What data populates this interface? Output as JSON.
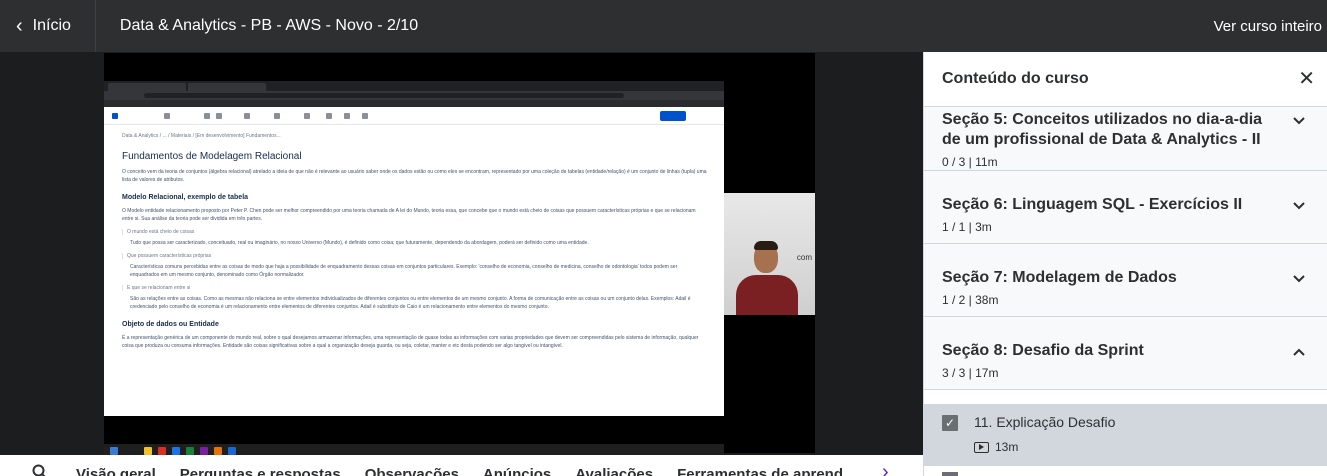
{
  "header": {
    "back_label": "Início",
    "course_title": "Data & Analytics - PB - AWS - Novo - 2/10",
    "view_course": "Ver curso inteiro"
  },
  "video": {
    "doc_crumbs": "Data & Analytics  /  ...  /  Materiais  /  [Em desenvolvimento] Fundamentos...",
    "doc_title": "Fundamentos de Modelagem Relacional",
    "doc_intro": "O conceito vem da teoria de conjuntos (álgebra relacional) atrelado a ideia de que não é relevante ao usuário saber onde os dados estão ou como eles se encontram, representado por uma coleção de tabelas (entidade/relação) é um conjunto de linhas (tupla) uma lista de valores de atributos.",
    "doc_h2a": "Modelo Relacional, exemplo de tabela",
    "doc_p2": "O Modelo entidade relacionamento proposto por Peter P. Chen pode ser melhor compreendido por uma teoria chamada de A lei do Mundo, teoria essa, que concebe que o mundo está cheio de coisas que possuem características próprias e que se relacionam entre si. Sua análise da teoria pode ser dividida em três partes.",
    "doc_q1": "O mundo está cheio de coisas",
    "doc_i1": "Tudo que possa ser caracterizado, conceituado, real ou imaginário, no nosso Universo (Mundo), é definido como coisa; que futuramente, dependendo da abordagem, poderá ser definido como uma entidade.",
    "doc_q2": "Que possuem características próprias",
    "doc_i2": "Características comuns percebidas entre as coisas de modo que haja a possibilidade de enquadramento dessas coisas em conjuntos particulares. Exemplo: 'conselho de economia, conselho de medicina, conselho de odontologia' todos podem ser enquadrados em um mesmo conjunto, denominado como Órgão normalizador.",
    "doc_q3": "E que se relacionam entre si",
    "doc_i3": "São as relações entre as coisas. Como as mesmas não relaciona se entre elementos individualizados de diferentes conjuntos ou entre elementos de um mesmo conjunto. A forma de comunicação entre as coisas ou um conjunto delas. Exemplos: Adail é credenciado pelo conselho de economia é um relacionamento entre elementos de diferentes conjuntos. Adail é substituto de Caio é um relacionamento entre elementos do mesmo conjunto.",
    "doc_h2b": "Objeto de dados ou Entidade",
    "doc_p3": "É a representação genérica de um componente do mundo real, sobre o qual desejamos armazenar informações, uma representação de quase todas as informações com varias propriedades que devem ser compreendidas pelo sistema de informação, qualquer coisa que produza ou consuma informações. Entidade são coisas significativas sobre a qual a organização deseja guarda, ou seja, coletar, manter e etc desta podendo ser algo tangível ou intangível.",
    "webcam_logo": "com"
  },
  "tabs": [
    "Visão geral",
    "Perguntas e respostas",
    "Observações",
    "Anúncios",
    "Avaliações",
    "Ferramentas de aprend"
  ],
  "sidebar": {
    "title": "Conteúdo do curso",
    "sections": [
      {
        "title": "Seção 5: Conceitos utilizados no dia-a-dia de um profissional de Data & Analytics - II",
        "meta": "0 / 3 | 11m",
        "expanded": false
      },
      {
        "title": "Seção 6: Linguagem SQL - Exercícios II",
        "meta": "1 / 1 | 3m",
        "expanded": false
      },
      {
        "title": "Seção 7: Modelagem de Dados",
        "meta": "1 / 2 | 38m",
        "expanded": false
      },
      {
        "title": "Seção 8: Desafio da Sprint",
        "meta": "3 / 3 | 17m",
        "expanded": true
      }
    ],
    "lesson": {
      "title": "11. Explicação Desafio",
      "duration": "13m",
      "completed": true
    }
  },
  "colors": {
    "header_bg": "#2d2f31",
    "accent": "#5624d0",
    "section_bg": "#f7f9fa",
    "active_lesson_bg": "#d1d7dc"
  }
}
